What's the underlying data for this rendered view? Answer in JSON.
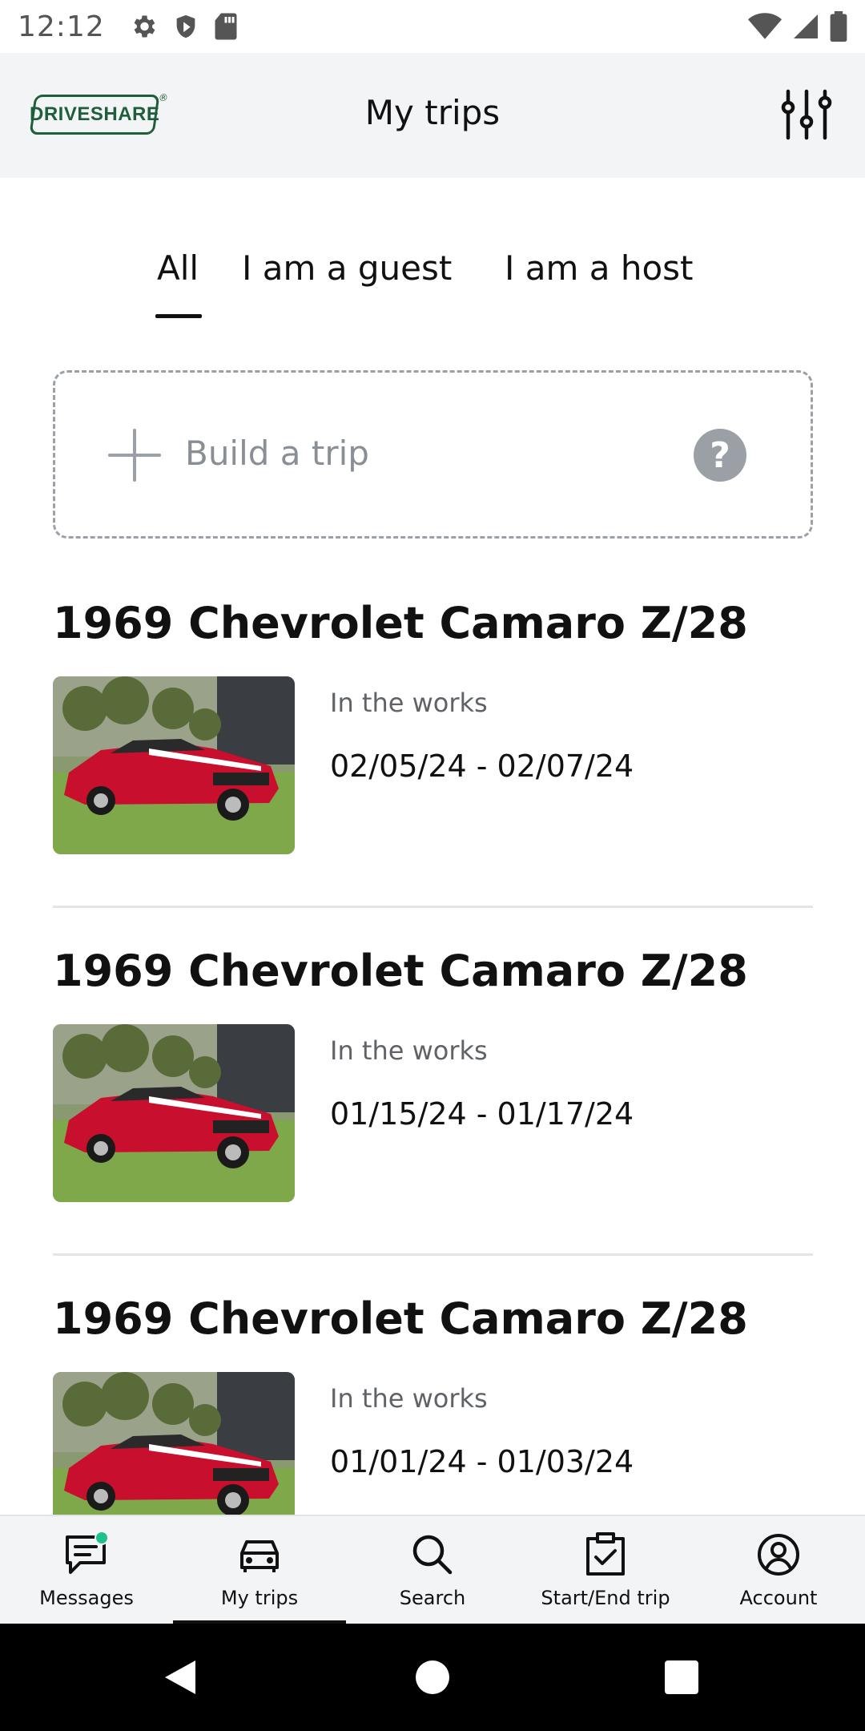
{
  "status_bar": {
    "time": "12:12",
    "left_icons": [
      "settings-gear-icon",
      "shield-icon",
      "sd-card-icon"
    ],
    "right_icons": [
      "wifi-icon",
      "cell-signal-icon",
      "battery-icon"
    ]
  },
  "header": {
    "logo_text": "DRIVESHARE",
    "logo_mark": "®",
    "title": "My trips",
    "filter_icon": "sliders-icon"
  },
  "tabs": [
    {
      "label": "All",
      "active": true
    },
    {
      "label": "I am a guest",
      "active": false
    },
    {
      "label": "I am a host",
      "active": false
    }
  ],
  "build_trip": {
    "label": "Build a trip",
    "help": "?"
  },
  "trips": [
    {
      "title": "1969 Chevrolet Camaro Z/28",
      "status": "In the works",
      "dates": "02/05/24 - 02/07/24",
      "photo": "red-camaro-photo"
    },
    {
      "title": "1969 Chevrolet Camaro Z/28",
      "status": "In the works",
      "dates": "01/15/24 - 01/17/24",
      "photo": "red-camaro-photo"
    },
    {
      "title": "1969 Chevrolet Camaro Z/28",
      "status": "In the works",
      "dates": "01/01/24 - 01/03/24",
      "photo": "red-camaro-photo"
    }
  ],
  "bottom_nav": [
    {
      "label": "Messages",
      "icon": "chat-icon",
      "badge": true
    },
    {
      "label": "My trips",
      "icon": "car-icon",
      "active": true
    },
    {
      "label": "Search",
      "icon": "search-icon"
    },
    {
      "label": "Start/End trip",
      "icon": "clipboard-check-icon"
    },
    {
      "label": "Account",
      "icon": "account-circle-icon"
    }
  ],
  "colors": {
    "brand_green": "#1f5e3a",
    "header_bg": "#f3f4f6",
    "muted_text": "#5f6368",
    "notification": "#1fc08e"
  }
}
